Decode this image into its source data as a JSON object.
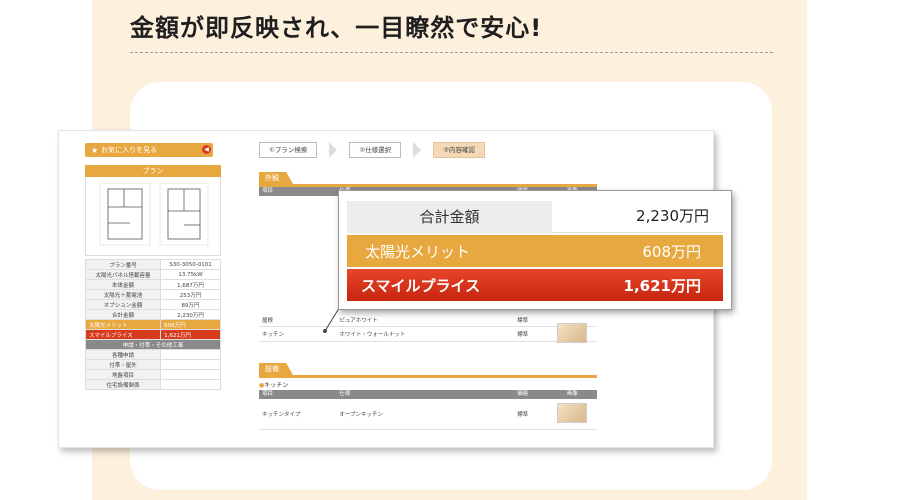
{
  "headline": "金額が即反映され、一目瞭然で安心!",
  "screen": {
    "favorites_button": "お気に入りを見る",
    "steps": [
      "①プラン検索",
      "②仕様選択",
      "③内容確認"
    ],
    "plan": {
      "header": "プラン",
      "specs": [
        {
          "label": "プラン番号",
          "value": "S30-3050-0101"
        },
        {
          "label": "太陽光パネル搭載容量",
          "value": "13.75kW"
        },
        {
          "label": "本体金額",
          "value": "1,687万円"
        },
        {
          "label": "太陽光＋蓄電池",
          "value": "253万円"
        },
        {
          "label": "オプション金額",
          "value": "89万円"
        },
        {
          "label": "合計金額",
          "value": "2,230万円"
        }
      ],
      "merit": {
        "label": "太陽光メリット",
        "value": "608万円"
      },
      "smile": {
        "label": "スマイルプライス",
        "value": "1,621万円"
      },
      "section": "申請・付帯・その他工事",
      "extra_rows": [
        "各種申請",
        "付帯・屋外",
        "地盤項目",
        "住宅設備関係"
      ]
    },
    "exterior": {
      "tab": "外観",
      "headers": [
        "項目",
        "仕様",
        "価格",
        "画像"
      ],
      "rows": [
        {
          "item": "屋根",
          "spec": "ピュアホワイト",
          "price": "標準"
        },
        {
          "item": "キッチン",
          "spec": "ホワイト・ウォールナット",
          "price": "標準"
        }
      ]
    },
    "interior": {
      "tab": "設備",
      "sub": "キッチン",
      "headers": [
        "項目",
        "仕様",
        "価格",
        "画像"
      ],
      "rows": [
        {
          "item": "キッチンタイプ",
          "spec": "オープンキッチン",
          "price": "標準"
        }
      ]
    }
  },
  "popup": {
    "total_label": "合計金額",
    "total_value": "2,230万円",
    "merit_label": "太陽光メリット",
    "merit_value": "608万円",
    "smile_label": "スマイルプライス",
    "smile_value": "1,621万円"
  },
  "colors": {
    "background": "#fdf0dc",
    "accent_orange": "#e8a840",
    "accent_red": "#d83a1e"
  }
}
